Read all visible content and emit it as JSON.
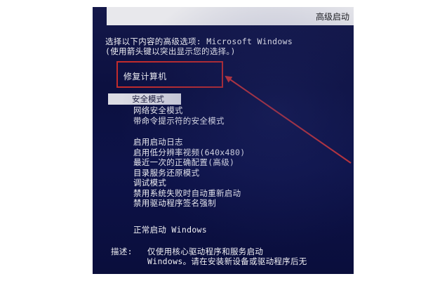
{
  "window": {
    "title": "高级启动"
  },
  "prompt": {
    "line1": "选择以下内容的高级选项: Microsoft Windows",
    "line2": "(使用箭头键以突出显示您的选择。)"
  },
  "menu": {
    "repair": "修复计算机",
    "selected": "安全模式",
    "group_a": [
      "网络安全模式",
      "带命令提示符的安全模式"
    ],
    "group_b": [
      "启用启动日志",
      "启用低分辨率视频(640x480)",
      "最近一次的正确配置(高级)",
      "目录服务还原模式",
      "调试模式",
      "禁用系统失败时自动重新启动",
      "禁用驱动程序签名强制"
    ],
    "normal_start": "正常启动 Windows"
  },
  "description": {
    "label": "描述:",
    "line1": "仅使用核心驱动程序和服务启动",
    "line2": "Windows。请在安装新设备或驱动程序后无"
  },
  "colors": {
    "screen_bg": "#0c1040",
    "text": "#f0f0f4",
    "highlight_box": "#c22b2b",
    "arrow": "#d03434",
    "selection_bg": "#dcdce4"
  }
}
